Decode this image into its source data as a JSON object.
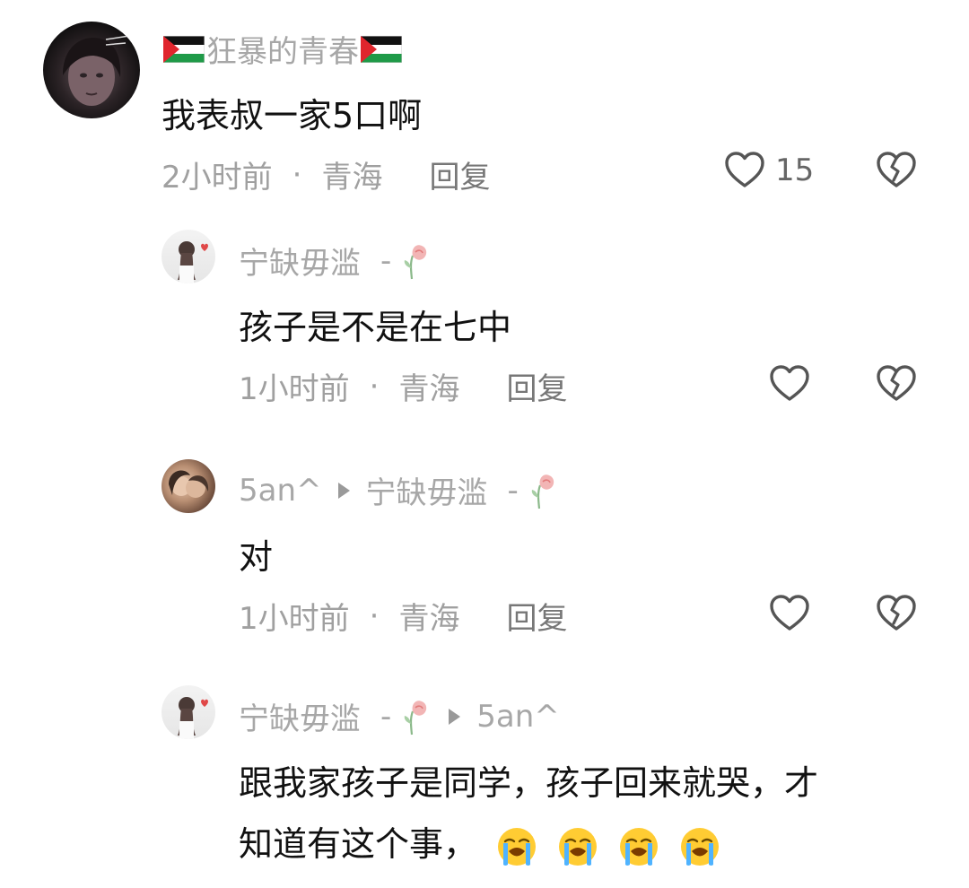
{
  "comments": [
    {
      "username": "狂暴的青春",
      "text": "我表叔一家5口啊",
      "time": "2小时前",
      "location": "青海",
      "reply_label": "回复",
      "likes": "15"
    },
    {
      "username": "宁缺毋滥",
      "suffix": "-",
      "text": "孩子是不是在七中",
      "time": "1小时前",
      "location": "青海",
      "reply_label": "回复"
    },
    {
      "username": "5an^",
      "reply_to": "宁缺毋滥",
      "reply_to_suffix": "-",
      "text": "对",
      "time": "1小时前",
      "location": "青海",
      "reply_label": "回复"
    },
    {
      "username": "宁缺毋滥",
      "suffix": "-",
      "reply_to": "5an^",
      "text_line1": "跟我家孩子是同学，孩子回来就哭，才",
      "text_line2": "知道有这个事，"
    }
  ],
  "separator": "·",
  "icons": {
    "like": "heart-outline-icon",
    "dislike": "broken-heart-icon",
    "flag": "palestine-flag-icon",
    "wilted_flower": "wilted-rose-icon",
    "reply_arrow": "play-arrow-icon",
    "crying_emoji": "loudly-crying-face-emoji"
  },
  "colors": {
    "text": "#111111",
    "muted": "#a0a0a0",
    "icon": "#555555"
  }
}
